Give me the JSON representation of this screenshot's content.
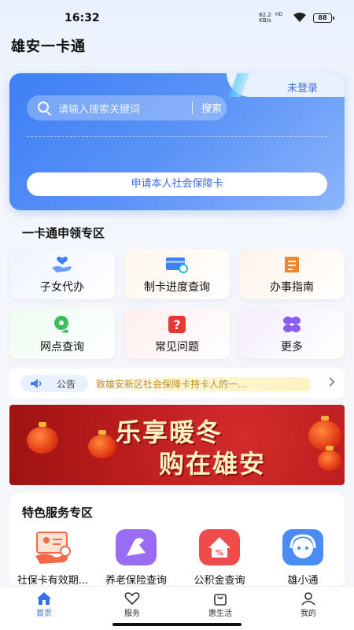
{
  "status": {
    "time": "16:32",
    "net_speed": "62.2",
    "net_unit": "KB/s",
    "net_label": "HD",
    "battery": "88"
  },
  "app": {
    "title": "雄安一卡通"
  },
  "hero": {
    "login_label": "未登录",
    "search_placeholder": "请输入搜索关键词",
    "search_button": "搜索",
    "apply_button": "申请本人社会保障卡"
  },
  "section_apply": {
    "title": "一卡通申领专区",
    "items": [
      {
        "label": "子女代办",
        "icon": "child-care-icon"
      },
      {
        "label": "制卡进度查询",
        "icon": "card-search-icon"
      },
      {
        "label": "办事指南",
        "icon": "guide-icon"
      },
      {
        "label": "网点查询",
        "icon": "location-icon"
      },
      {
        "label": "常见问题",
        "icon": "question-icon"
      },
      {
        "label": "更多",
        "icon": "more-icon"
      }
    ]
  },
  "notice": {
    "tag": "公告",
    "text": "致雄安新区社会保障卡持卡人的一..."
  },
  "banner": {
    "line1": "乐享暖冬",
    "line2": "购在雄安"
  },
  "section_featured": {
    "title": "特色服务专区",
    "items": [
      {
        "label": "社保卡有效期...",
        "icon": "card-validity-icon"
      },
      {
        "label": "养老保险查询",
        "icon": "pension-icon"
      },
      {
        "label": "公积金查询",
        "icon": "housing-fund-icon"
      },
      {
        "label": "雄小通",
        "icon": "assistant-icon"
      }
    ]
  },
  "tabbar": {
    "items": [
      {
        "label": "首页",
        "icon": "home-icon",
        "active": true
      },
      {
        "label": "服务",
        "icon": "heart-icon",
        "active": false
      },
      {
        "label": "惠生活",
        "icon": "shopping-bag-icon",
        "active": false
      },
      {
        "label": "我的",
        "icon": "profile-icon",
        "active": false
      }
    ]
  },
  "colors": {
    "accent": "#3d7ff5",
    "tab_active": "#3a6fe0",
    "notice_text": "#c08a22",
    "banner_red": "#b81c1c"
  }
}
